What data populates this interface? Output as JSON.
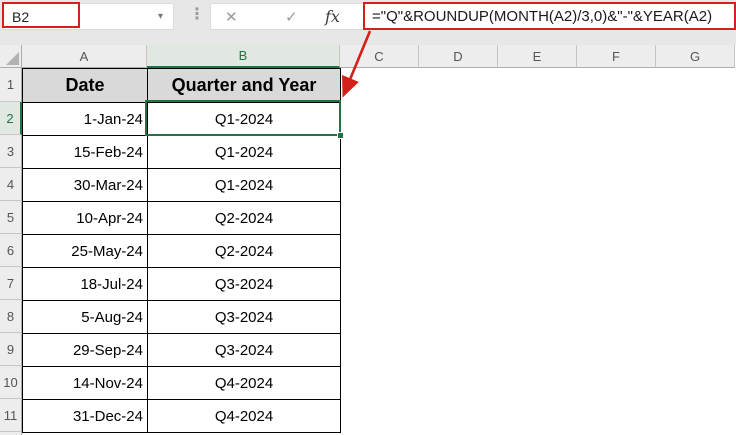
{
  "toolbar": {
    "name_box": {
      "value": "B2"
    },
    "formula_bar": {
      "formula": "=\"Q\"&ROUNDUP(MONTH(A2)/3,0)&\"-\"&YEAR(A2)"
    },
    "icons": {
      "dropdown": "▾",
      "separator_dots": "⋮",
      "cancel": "✕",
      "enter": "✓",
      "insert_function": "fx"
    }
  },
  "grid": {
    "selected_cell": "B2",
    "selected_column": "B",
    "selected_row": 2,
    "column_headers": [
      "A",
      "B",
      "C",
      "D",
      "E",
      "F",
      "G"
    ],
    "row_headers": [
      1,
      2,
      3,
      4,
      5,
      6,
      7,
      8,
      9,
      10,
      11
    ],
    "table": {
      "header_row": {
        "row": 1,
        "date_label": "Date",
        "quarter_label": "Quarter and Year"
      },
      "rows": [
        {
          "row": 2,
          "date": "1-Jan-24",
          "quarter": "Q1-2024"
        },
        {
          "row": 3,
          "date": "15-Feb-24",
          "quarter": "Q1-2024"
        },
        {
          "row": 4,
          "date": "30-Mar-24",
          "quarter": "Q1-2024"
        },
        {
          "row": 5,
          "date": "10-Apr-24",
          "quarter": "Q2-2024"
        },
        {
          "row": 6,
          "date": "25-May-24",
          "quarter": "Q2-2024"
        },
        {
          "row": 7,
          "date": "18-Jul-24",
          "quarter": "Q3-2024"
        },
        {
          "row": 8,
          "date": "5-Aug-24",
          "quarter": "Q3-2024"
        },
        {
          "row": 9,
          "date": "29-Sep-24",
          "quarter": "Q3-2024"
        },
        {
          "row": 10,
          "date": "14-Nov-24",
          "quarter": "Q4-2024"
        },
        {
          "row": 11,
          "date": "31-Dec-24",
          "quarter": "Q4-2024"
        }
      ]
    }
  },
  "colors": {
    "annotation_red": "#d32018",
    "excel_green": "#217346",
    "table_header_fill": "#d9d9d9"
  }
}
